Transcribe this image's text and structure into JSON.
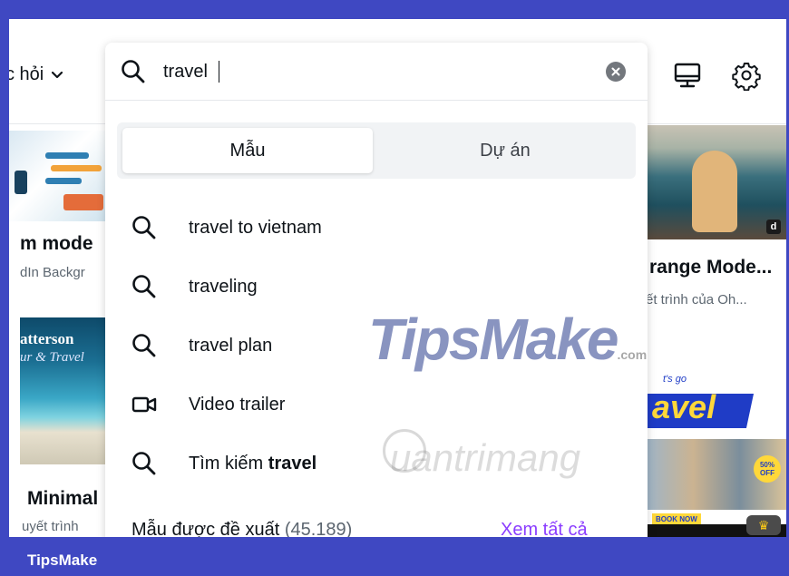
{
  "header": {
    "learn_menu_label": "c hỏi"
  },
  "search": {
    "query": "travel",
    "placeholder": ""
  },
  "tabs": [
    {
      "label": "Mẫu",
      "active": true
    },
    {
      "label": "Dự án",
      "active": false
    }
  ],
  "suggestions": [
    {
      "icon": "search-icon",
      "label": "travel to vietnam"
    },
    {
      "icon": "search-icon",
      "label": "traveling"
    },
    {
      "icon": "search-icon",
      "label": "travel plan"
    },
    {
      "icon": "video-camera-icon",
      "label": "Video trailer"
    },
    {
      "icon": "search-icon",
      "prefix": "Tìm kiếm ",
      "bold": "travel"
    }
  ],
  "recommended": {
    "label": "Mẫu được đề xuất",
    "count": "(45.189)",
    "see_all": "Xem tất cả"
  },
  "left_cards": [
    {
      "title": "m mode",
      "subtitle": "dIn Backgr"
    },
    {
      "thumb_line1": "atterson",
      "thumb_line2": "ur & Travel",
      "title": "Minimal",
      "subtitle": "uyết trình"
    }
  ],
  "right_cards": [
    {
      "badge": "d",
      "title": "range Mode...",
      "subtitle": "ết trình của Oh..."
    },
    {
      "pretitle": "t's go",
      "word": "avel",
      "offer": "50% OFF",
      "book": "BOOK NOW",
      "crown": "♛"
    }
  ],
  "watermarks": {
    "primary": "TipsMake",
    "primary_suffix": ".com",
    "secondary": "uantrimang"
  },
  "frame": {
    "brand": "TipsMake"
  },
  "colors": {
    "frame": "#3f48c2",
    "accent_link": "#8b3dff",
    "text": "#0e1318"
  }
}
